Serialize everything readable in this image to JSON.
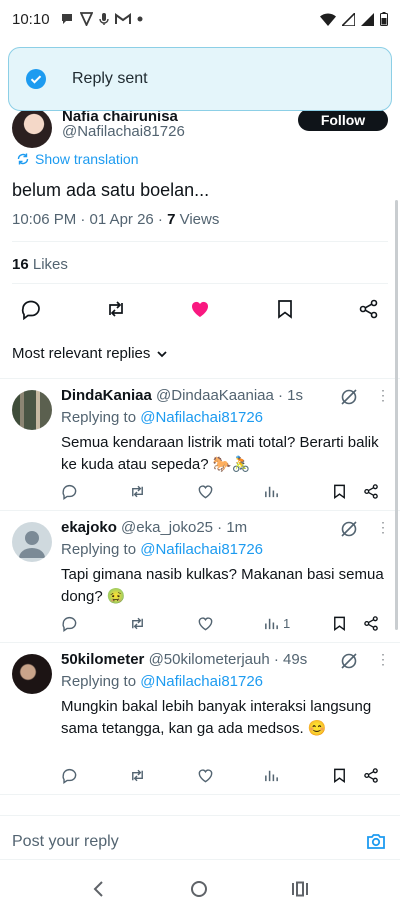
{
  "status_bar": {
    "time": "10:10"
  },
  "toast": {
    "message": "Reply sent"
  },
  "post": {
    "author_name": "Nafia chairunisa",
    "author_handle": "@Nafilachai81726",
    "follow_label": "Follow",
    "show_translation": "Show translation",
    "text": "belum ada satu boelan...",
    "timestamp": "10:06 PM · 01 Apr 26 · ",
    "views_count": "7",
    "views_label": " Views",
    "likes_count": "16",
    "likes_label": " Likes"
  },
  "replies_sort": {
    "label": "Most relevant replies"
  },
  "replies": [
    {
      "name": "DindaKaniaa",
      "handle": "@DindaaKaaniaa · 1s",
      "replying_prefix": "Replying to ",
      "replying_to": "@Nafilachai81726",
      "text": "Semua kendaraan listrik mati total? Berarti balik ke kuda atau sepeda? 🐎🚴",
      "views": ""
    },
    {
      "name": "ekajoko",
      "handle": "@eka_joko25 · 1m",
      "replying_prefix": "Replying to ",
      "replying_to": "@Nafilachai81726",
      "text": "Tapi gimana nasib kulkas? Makanan basi semua dong? 🤢",
      "views": "1"
    },
    {
      "name": "50kilometer",
      "handle": "@50kilometerjauh · 49s",
      "replying_prefix": "Replying to ",
      "replying_to": "@Nafilachai81726",
      "text": "Mungkin bakal lebih banyak interaksi langsung sama tetangga, kan ga ada medsos. 😊",
      "views": ""
    }
  ],
  "composer": {
    "placeholder": "Post your reply"
  },
  "colors": {
    "accent": "#1d9bf0",
    "like": "#f91880",
    "text": "#0f1419",
    "muted": "#536471",
    "toast_bg": "#e4f5fa"
  }
}
